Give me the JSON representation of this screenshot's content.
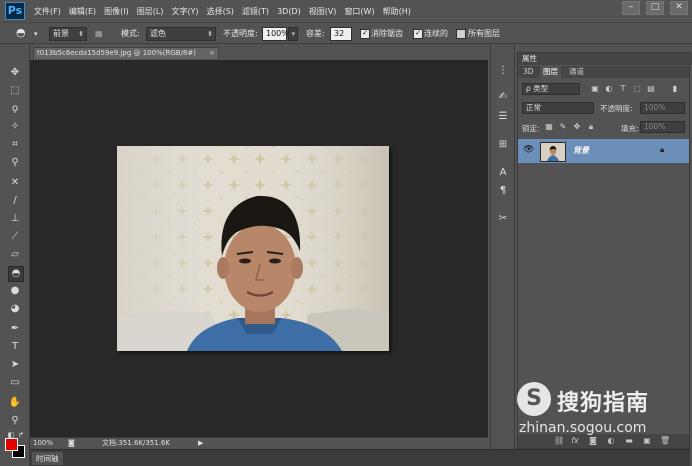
{
  "app": {
    "logo": "Ps",
    "menu": [
      "文件(F)",
      "编辑(E)",
      "图像(I)",
      "图层(L)",
      "文字(Y)",
      "选择(S)",
      "滤镜(T)",
      "3D(D)",
      "视图(V)",
      "窗口(W)",
      "帮助(H)"
    ],
    "window_controls": [
      "–",
      "□",
      "✕"
    ]
  },
  "options": {
    "fill_source": "前景",
    "mode_label": "模式:",
    "mode_value": "滤色",
    "opacity_label": "不透明度:",
    "opacity_value": "100%",
    "tolerance_label": "容差:",
    "tolerance_value": "32",
    "antialias_label": "消除锯齿",
    "contiguous_label": "连续的",
    "all_layers_label": "所有图层"
  },
  "document": {
    "tab_title": "t013b5c6ecda15d59e9.jpg @ 100%(RGB/8#)",
    "close": "×"
  },
  "status": {
    "zoom": "100%",
    "doc_info": "文档:351.6K/351.6K",
    "arrow": "▶"
  },
  "timeline": {
    "tab": "时间轴"
  },
  "panel": {
    "properties_tab": "属性",
    "tabs": [
      "3D",
      "图层",
      "通道"
    ],
    "filter_label": "ρ 类型",
    "blend_mode": "正常",
    "opacity_label": "不透明度:",
    "opacity_value": "100%",
    "lock_label": "锁定:",
    "fill_label": "填充:",
    "fill_value": "100%",
    "layer_name": "背景"
  },
  "watermark": {
    "logo": "S",
    "text": "搜狗指南",
    "url": "zhinan.sogou.com"
  },
  "colors": {
    "foreground": "#e00000",
    "background": "#000000",
    "selected_layer": "#6b8fb8"
  }
}
